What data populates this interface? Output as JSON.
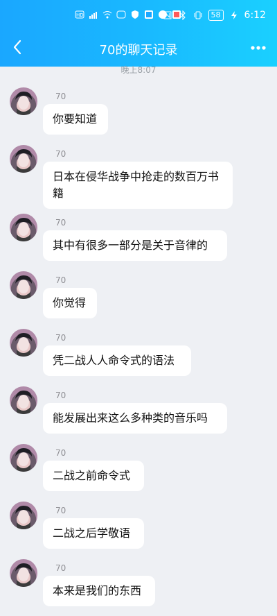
{
  "status": {
    "time": "6:12",
    "battery": "58"
  },
  "header": {
    "title": "70的聊天记录"
  },
  "time_stub": "晚上8:07",
  "messages": [
    {
      "sender": "70",
      "text": "你要知道"
    },
    {
      "sender": "70",
      "text": "日本在侵华战争中抢走的数百万书籍"
    },
    {
      "sender": "70",
      "text": "其中有很多一部分是关于音律的"
    },
    {
      "sender": "70",
      "text": "你觉得"
    },
    {
      "sender": "70",
      "text": "凭二战人人命令式的语法"
    },
    {
      "sender": "70",
      "text": "能发展出来这么多种类的音乐吗"
    },
    {
      "sender": "70",
      "text": "二战之前命令式"
    },
    {
      "sender": "70",
      "text": "二战之后学敬语"
    },
    {
      "sender": "70",
      "text": "本来是我们的东西"
    }
  ]
}
